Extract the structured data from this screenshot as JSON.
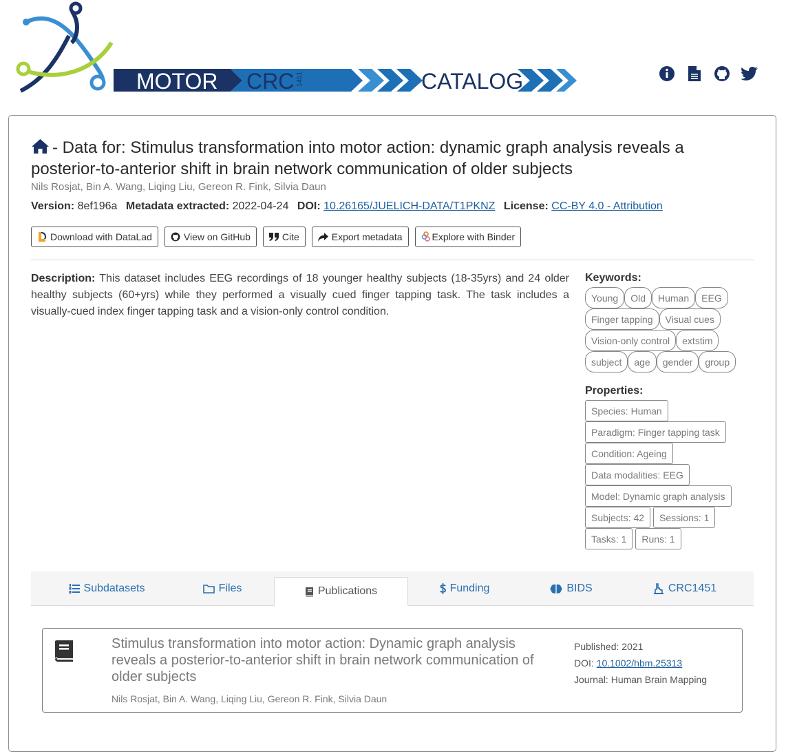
{
  "header": {
    "logo": {
      "text_motor": "MOTOR",
      "text_crc": "CRC",
      "text_crc_num": "1451",
      "text_catalog": "CATALOG"
    },
    "icons": [
      "info-icon",
      "document-icon",
      "github-icon",
      "twitter-icon"
    ]
  },
  "dataset": {
    "title_prefix": "- Data for: Stimulus transformation into motor action: dynamic graph analysis reveals a posterior-to-anterior shift in brain network communication of older subjects",
    "authors": "Nils Rosjat, Bin A. Wang, Liqing Liu, Gereon R. Fink, Silvia Daun",
    "version_label": "Version:",
    "version": "8ef196a",
    "extracted_label": "Metadata extracted:",
    "extracted": "2022-04-24",
    "doi_label": "DOI:",
    "doi": "10.26165/JUELICH-DATA/T1PKNZ",
    "license_label": "License:",
    "license": "CC-BY 4.0 - Attribution"
  },
  "actions": {
    "datalad": "Download with DataLad",
    "github": "View on GitHub",
    "cite": "Cite",
    "export": "Export metadata",
    "binder": "Explore with Binder"
  },
  "description": {
    "label": "Description:",
    "text": "This dataset includes EEG recordings of 18 younger healthy subjects (18-35yrs) and 24 older healthy subjects (60+yrs) while they performed a visually cued finger tapping task. The task includes a visually-cued index finger tapping task and a vision-only control condition."
  },
  "keywords": {
    "label": "Keywords:",
    "items": [
      "Young",
      "Old",
      "Human",
      "EEG",
      "Finger tapping",
      "Visual cues",
      "Vision-only control",
      "extstim",
      "subject",
      "age",
      "gender",
      "group"
    ]
  },
  "properties": {
    "label": "Properties:",
    "items": [
      "Species: Human",
      "Paradigm: Finger tapping task",
      "Condition: Ageing",
      "Data modalities: EEG",
      "Model: Dynamic graph analysis",
      "Subjects: 42",
      "Sessions: 1",
      "Tasks: 1",
      "Runs: 1"
    ]
  },
  "tabs": {
    "subdatasets": "Subdatasets",
    "files": "Files",
    "publications": "Publications",
    "funding": "Funding",
    "bids": "BIDS",
    "crc": "CRC1451"
  },
  "publication": {
    "title": "Stimulus transformation into motor action: Dynamic graph analysis reveals a posterior-to-anterior shift in brain network communication of older subjects",
    "authors": "Nils Rosjat, Bin A. Wang, Liqing Liu, Gereon R. Fink, Silvia Daun",
    "published_label": "Published:",
    "published": "2021",
    "doi_label": "DOI:",
    "doi": "10.1002/hbm.25313",
    "journal_label": "Journal:",
    "journal": "Human Brain Mapping"
  },
  "colors": {
    "navy": "#1b3364",
    "blue": "#1d6fb6",
    "lightblue": "#3a8fd3",
    "green": "#a9cf3c",
    "link": "#2a6fb0"
  }
}
